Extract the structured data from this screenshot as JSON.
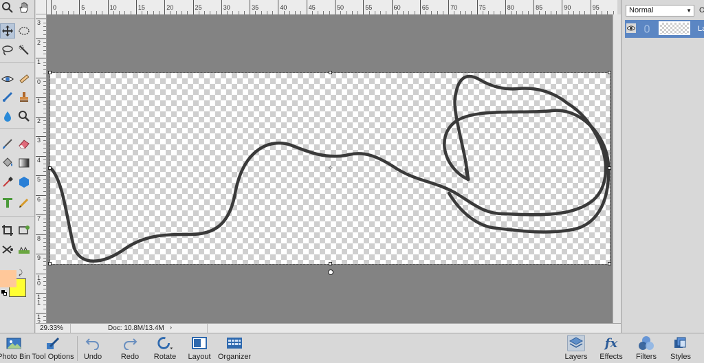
{
  "document": {
    "zoom": "29.33%",
    "doc_info": "Doc: 10.8M/13.4M",
    "status_arrow": "›"
  },
  "rulers": {
    "top_labels": [
      "0",
      "5",
      "10",
      "15",
      "20",
      "25",
      "30",
      "35",
      "40",
      "45",
      "50",
      "55",
      "60",
      "65",
      "70",
      "75",
      "80",
      "85",
      "90",
      "95"
    ],
    "left_labels": [
      "3",
      "2",
      "1",
      "0",
      "1",
      "2",
      "3",
      "4",
      "5",
      "6",
      "7",
      "8",
      "9",
      "10",
      "11",
      "12"
    ]
  },
  "layers_panel": {
    "blend_mode": "Normal",
    "opacity_label": "O",
    "layer_name": "La"
  },
  "colors": {
    "foreground": "#ffc89a",
    "background": "#ffff33",
    "selected_layer": "#5b86c3"
  },
  "tools": [
    "zoom-icon",
    "hand-icon",
    "move-icon",
    "marquee-icon",
    "lasso-icon",
    "quick-selection-icon",
    "eye-icon",
    "straighten-icon",
    "smart-brush-icon",
    "clone-stamp-icon",
    "blur-icon",
    "sponge-icon",
    "brush-icon",
    "eraser-icon",
    "paint-bucket-icon",
    "gradient-icon",
    "eyedropper-icon",
    "shape-icon",
    "type-icon",
    "pencil-icon",
    "crop-icon",
    "recompose-icon",
    "content-move-icon",
    "straighten-tool-icon"
  ],
  "taskbar": {
    "photo_bin": "Photo Bin",
    "tool_options": "Tool Options",
    "undo": "Undo",
    "redo": "Redo",
    "rotate": "Rotate",
    "layout": "Layout",
    "organizer": "Organizer",
    "layers": "Layers",
    "effects": "Effects",
    "filters": "Filters",
    "styles": "Styles",
    "effects_glyph": "fx"
  }
}
